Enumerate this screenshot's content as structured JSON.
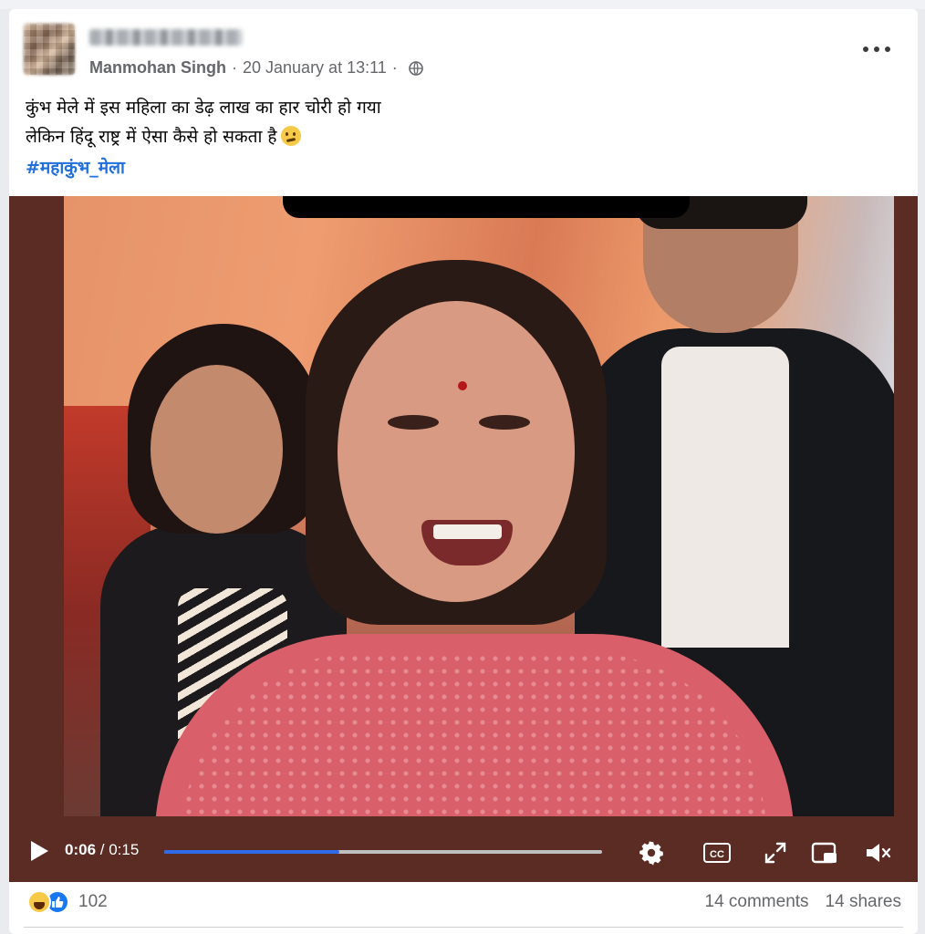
{
  "post": {
    "author": "Manmohan Singh",
    "separator": "·",
    "timestamp": "20 January at 13:11",
    "privacy_icon": "globe-icon",
    "text_line1": "कुंभ मेले में इस महिला का डेढ़ लाख का हार चोरी हो गया",
    "text_line2": "लेकिन हिंदू राष्ट्र में ऐसा कैसे हो सकता है",
    "emoji": "thinking-face-emoji",
    "hashtag": "#महाकुंभ_मेला"
  },
  "video": {
    "current_time": "0:06",
    "time_separator": " / ",
    "duration": "0:15",
    "progress_fraction": 0.4,
    "accent_color": "#2f6be6",
    "icons": [
      "play-icon",
      "settings-gear-icon",
      "closed-captions-icon",
      "fullscreen-icon",
      "picture-in-picture-icon",
      "mute-icon"
    ]
  },
  "footer": {
    "reaction_icons": [
      "haha-reaction-icon",
      "like-reaction-icon"
    ],
    "reaction_count": "102",
    "comments": "14 comments",
    "shares": "14 shares"
  }
}
